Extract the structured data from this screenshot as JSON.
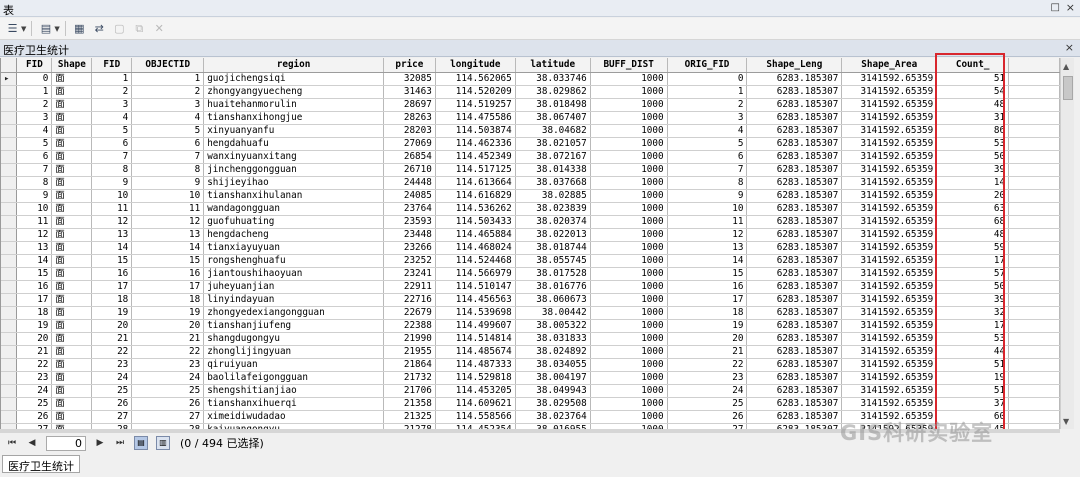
{
  "window": {
    "title": "表",
    "pin_glyph": "□",
    "close_glyph": "×"
  },
  "toolbar": {
    "icons": [
      "table-options-icon",
      "related-tables-icon",
      "select-by-attributes-icon",
      "switch-selection-icon",
      "clear-selection-icon",
      "zoom-to-selected-icon",
      "delete-selected-icon"
    ]
  },
  "tab": {
    "title": "医疗卫生统计",
    "close_glyph": "×"
  },
  "table": {
    "columns": [
      "FID",
      "Shape",
      "FID",
      "OBJECTID",
      "region",
      "price",
      "longitude",
      "latitude",
      "BUFF_DIST",
      "ORIG_FID",
      "Shape_Leng",
      "Shape_Area",
      "Count_"
    ],
    "rows": [
      [
        "0",
        "面",
        "1",
        "1",
        "guojichengsiqi",
        "32085",
        "114.562065",
        "38.033746",
        "1000",
        "0",
        "6283.185307",
        "3141592.65359",
        "51"
      ],
      [
        "1",
        "面",
        "2",
        "2",
        "zhongyangyuecheng",
        "31463",
        "114.520209",
        "38.029862",
        "1000",
        "1",
        "6283.185307",
        "3141592.65359",
        "54"
      ],
      [
        "2",
        "面",
        "3",
        "3",
        "huaitehanmorulin",
        "28697",
        "114.519257",
        "38.018498",
        "1000",
        "2",
        "6283.185307",
        "3141592.65359",
        "48"
      ],
      [
        "3",
        "面",
        "4",
        "4",
        "tianshanxihongjue",
        "28263",
        "114.475586",
        "38.067407",
        "1000",
        "3",
        "6283.185307",
        "3141592.65359",
        "31"
      ],
      [
        "4",
        "面",
        "5",
        "5",
        "xinyuanyanfu",
        "28203",
        "114.503874",
        "38.04682",
        "1000",
        "4",
        "6283.185307",
        "3141592.65359",
        "86"
      ],
      [
        "5",
        "面",
        "6",
        "6",
        "hengdahuafu",
        "27069",
        "114.462336",
        "38.021057",
        "1000",
        "5",
        "6283.185307",
        "3141592.65359",
        "53"
      ],
      [
        "6",
        "面",
        "7",
        "7",
        "wanxinyuanxitang",
        "26854",
        "114.452349",
        "38.072167",
        "1000",
        "6",
        "6283.185307",
        "3141592.65359",
        "50"
      ],
      [
        "7",
        "面",
        "8",
        "8",
        "jinchenggongguan",
        "26710",
        "114.517125",
        "38.014338",
        "1000",
        "7",
        "6283.185307",
        "3141592.65359",
        "39"
      ],
      [
        "8",
        "面",
        "9",
        "9",
        "shijieyihao",
        "24448",
        "114.613664",
        "38.037668",
        "1000",
        "8",
        "6283.185307",
        "3141592.65359",
        "14"
      ],
      [
        "9",
        "面",
        "10",
        "10",
        "tianshanxihulanan",
        "24085",
        "114.616829",
        "38.02885",
        "1000",
        "9",
        "6283.185307",
        "3141592.65359",
        "20"
      ],
      [
        "10",
        "面",
        "11",
        "11",
        "wandagongguan",
        "23764",
        "114.536262",
        "38.023839",
        "1000",
        "10",
        "6283.185307",
        "3141592.65359",
        "63"
      ],
      [
        "11",
        "面",
        "12",
        "12",
        "guofuhuating",
        "23593",
        "114.503433",
        "38.020374",
        "1000",
        "11",
        "6283.185307",
        "3141592.65359",
        "68"
      ],
      [
        "12",
        "面",
        "13",
        "13",
        "hengdacheng",
        "23448",
        "114.465884",
        "38.022013",
        "1000",
        "12",
        "6283.185307",
        "3141592.65359",
        "48"
      ],
      [
        "13",
        "面",
        "14",
        "14",
        "tianxiayuyuan",
        "23266",
        "114.468024",
        "38.018744",
        "1000",
        "13",
        "6283.185307",
        "3141592.65359",
        "59"
      ],
      [
        "14",
        "面",
        "15",
        "15",
        "rongshenghuafu",
        "23252",
        "114.524468",
        "38.055745",
        "1000",
        "14",
        "6283.185307",
        "3141592.65359",
        "17"
      ],
      [
        "15",
        "面",
        "16",
        "16",
        "jiantoushihaoyuan",
        "23241",
        "114.566979",
        "38.017528",
        "1000",
        "15",
        "6283.185307",
        "3141592.65359",
        "57"
      ],
      [
        "16",
        "面",
        "17",
        "17",
        "juheyuanjian",
        "22911",
        "114.510147",
        "38.016776",
        "1000",
        "16",
        "6283.185307",
        "3141592.65359",
        "50"
      ],
      [
        "17",
        "面",
        "18",
        "18",
        "linyindayuan",
        "22716",
        "114.456563",
        "38.060673",
        "1000",
        "17",
        "6283.185307",
        "3141592.65359",
        "39"
      ],
      [
        "18",
        "面",
        "19",
        "19",
        "zhongyedexiangongguan",
        "22679",
        "114.539698",
        "38.00442",
        "1000",
        "18",
        "6283.185307",
        "3141592.65359",
        "32"
      ],
      [
        "19",
        "面",
        "20",
        "20",
        "tianshanjiufeng",
        "22388",
        "114.499607",
        "38.005322",
        "1000",
        "19",
        "6283.185307",
        "3141592.65359",
        "17"
      ],
      [
        "20",
        "面",
        "21",
        "21",
        "shangdugongyu",
        "21990",
        "114.514814",
        "38.031833",
        "1000",
        "20",
        "6283.185307",
        "3141592.65359",
        "53"
      ],
      [
        "21",
        "面",
        "22",
        "22",
        "zhonglijingyuan",
        "21955",
        "114.485674",
        "38.024892",
        "1000",
        "21",
        "6283.185307",
        "3141592.65359",
        "44"
      ],
      [
        "22",
        "面",
        "23",
        "23",
        "qiruiyuan",
        "21864",
        "114.487333",
        "38.034055",
        "1000",
        "22",
        "6283.185307",
        "3141592.65359",
        "51"
      ],
      [
        "23",
        "面",
        "24",
        "24",
        "baolilafeigongguan",
        "21732",
        "114.529818",
        "38.004197",
        "1000",
        "23",
        "6283.185307",
        "3141592.65359",
        "19"
      ],
      [
        "24",
        "面",
        "25",
        "25",
        "shengshitianjiao",
        "21706",
        "114.453205",
        "38.049943",
        "1000",
        "24",
        "6283.185307",
        "3141592.65359",
        "51"
      ],
      [
        "25",
        "面",
        "26",
        "26",
        "tianshanxihuerqi",
        "21358",
        "114.609621",
        "38.029508",
        "1000",
        "25",
        "6283.185307",
        "3141592.65359",
        "37"
      ],
      [
        "26",
        "面",
        "27",
        "27",
        "ximeidiwudadao",
        "21325",
        "114.558566",
        "38.023764",
        "1000",
        "26",
        "6283.185307",
        "3141592.65359",
        "60"
      ],
      [
        "27",
        "面",
        "28",
        "28",
        "kaiyuangongyu",
        "21278",
        "114.452354",
        "38.016955",
        "1000",
        "27",
        "6283.185307",
        "3141592.65359",
        "45"
      ],
      [
        "28",
        "面",
        "29",
        "29",
        "yuancheng",
        "21243",
        "114.520709",
        "38.051533",
        "1000",
        "28",
        "6283.185307",
        "3141592.65359",
        "45"
      ]
    ]
  },
  "navigator": {
    "current": "0",
    "status": "(0 / 494 已选择)"
  },
  "bottom_tab": {
    "label": "医疗卫生统计"
  },
  "watermark": {
    "text": "GIS科研实验室"
  },
  "colors": {
    "highlight": "#d8262d"
  }
}
